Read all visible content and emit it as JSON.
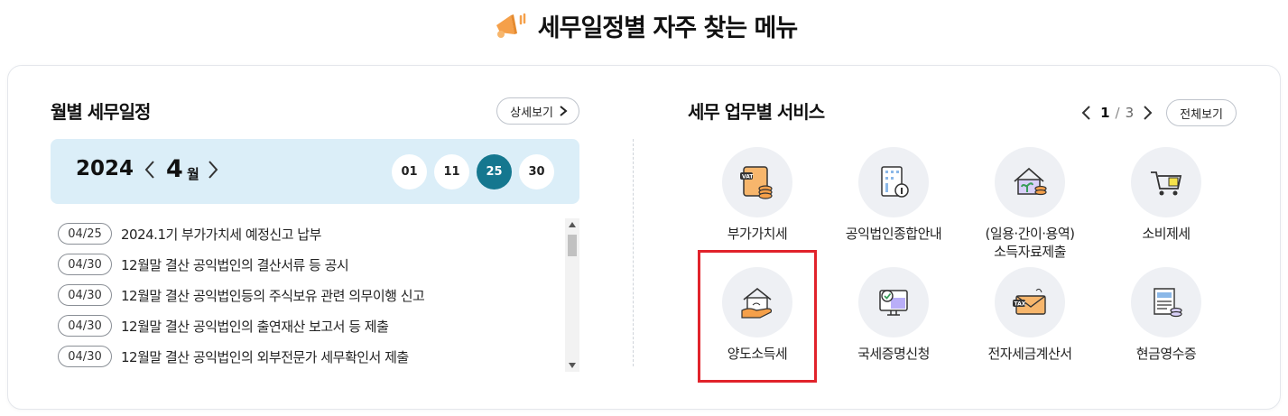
{
  "header": {
    "title": "세무일정별 자주 찾는 메뉴"
  },
  "schedule": {
    "title": "월별 세무일정",
    "detail_label": "상세보기",
    "year": "2024",
    "month": "4",
    "month_unit": "월",
    "days": [
      "01",
      "11",
      "25",
      "30"
    ],
    "active_day": "25",
    "items": [
      {
        "date": "04/25",
        "text": "2024.1기 부가가치세 예정신고 납부"
      },
      {
        "date": "04/30",
        "text": "12월말 결산 공익법인의 결산서류 등 공시"
      },
      {
        "date": "04/30",
        "text": "12월말 결산 공익법인등의 주식보유 관련 의무이행 신고"
      },
      {
        "date": "04/30",
        "text": "12월말 결산 공익법인의 출연재산 보고서 등 제출"
      },
      {
        "date": "04/30",
        "text": "12월말 결산 공익법인의 외부전문가 세무확인서 제출"
      }
    ]
  },
  "services": {
    "title": "세무 업무별 서비스",
    "page_current": "1",
    "page_sep": "/",
    "page_total": "3",
    "all_label": "전체보기",
    "items": [
      {
        "line1": "부가가치세",
        "line2": "",
        "icon": "vat-document-icon"
      },
      {
        "line1": "공익법인종합안내",
        "line2": "",
        "icon": "building-info-icon"
      },
      {
        "line1": "(일용·간이·용역)",
        "line2": "소득자료제출",
        "icon": "house-plant-coins-icon"
      },
      {
        "line1": "소비제세",
        "line2": "",
        "icon": "shopping-cart-icon"
      },
      {
        "line1": "양도소득세",
        "line2": "",
        "icon": "house-hand-icon"
      },
      {
        "line1": "국세증명신청",
        "line2": "",
        "icon": "certificate-monitor-icon"
      },
      {
        "line1": "전자세금계산서",
        "line2": "",
        "icon": "tax-envelope-icon"
      },
      {
        "line1": "현금영수증",
        "line2": "",
        "icon": "receipt-coins-icon"
      }
    ]
  },
  "colors": {
    "accent": "#15778f",
    "month_bar": "#dbeef8",
    "highlight": "#e1232b",
    "icon_bg": "#eef0f4",
    "orange": "#f5a04a",
    "purple": "#8b7ff0"
  }
}
